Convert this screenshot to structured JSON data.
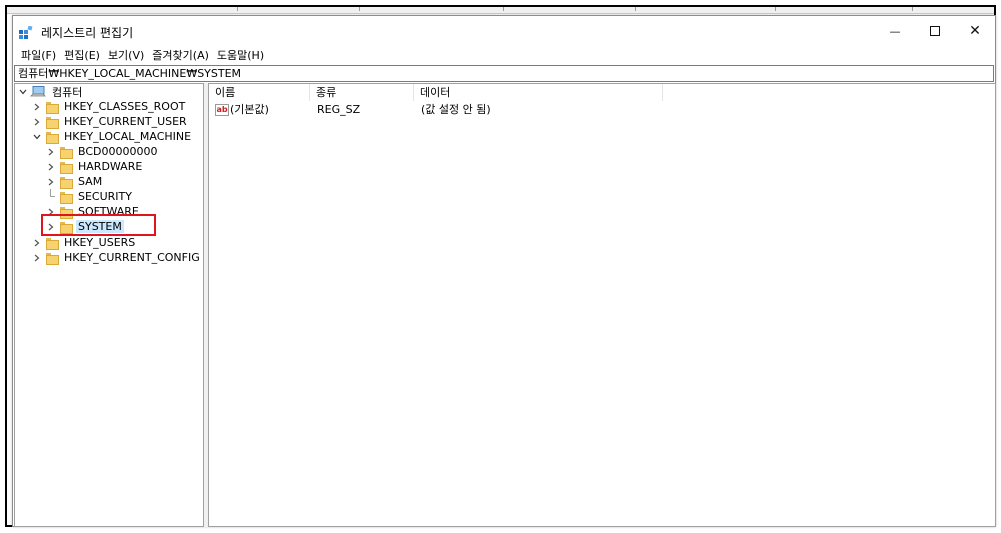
{
  "window": {
    "title": "레지스트리 편집기",
    "controls": {
      "minimize": "—",
      "close": "✕"
    }
  },
  "menu": [
    "파일(F)",
    "편집(E)",
    "보기(V)",
    "즐겨찾기(A)",
    "도움말(H)"
  ],
  "address": "컴퓨터₩HKEY_LOCAL_MACHINE₩SYSTEM",
  "tree": {
    "root": "컴퓨터",
    "hives": [
      "HKEY_CLASSES_ROOT",
      "HKEY_CURRENT_USER",
      "HKEY_LOCAL_MACHINE",
      "HKEY_USERS",
      "HKEY_CURRENT_CONFIG"
    ],
    "local_machine_children": [
      "BCD00000000",
      "HARDWARE",
      "SAM",
      "SECURITY",
      "SOFTWARE",
      "SYSTEM"
    ],
    "selected": "SYSTEM"
  },
  "list": {
    "columns": [
      "이름",
      "종류",
      "데이터"
    ],
    "rows": [
      {
        "name": "(기본값)",
        "type": "REG_SZ",
        "data": "(값 설정 안 됨)"
      }
    ]
  },
  "icons": {
    "app": "registry-editor-icon",
    "root": "computer-icon",
    "folder": "folder-icon",
    "value": "string-value-icon"
  },
  "colors": {
    "selection": "#cce8ff",
    "highlight_box": "#e0141e",
    "folder": "#f6d36e"
  }
}
